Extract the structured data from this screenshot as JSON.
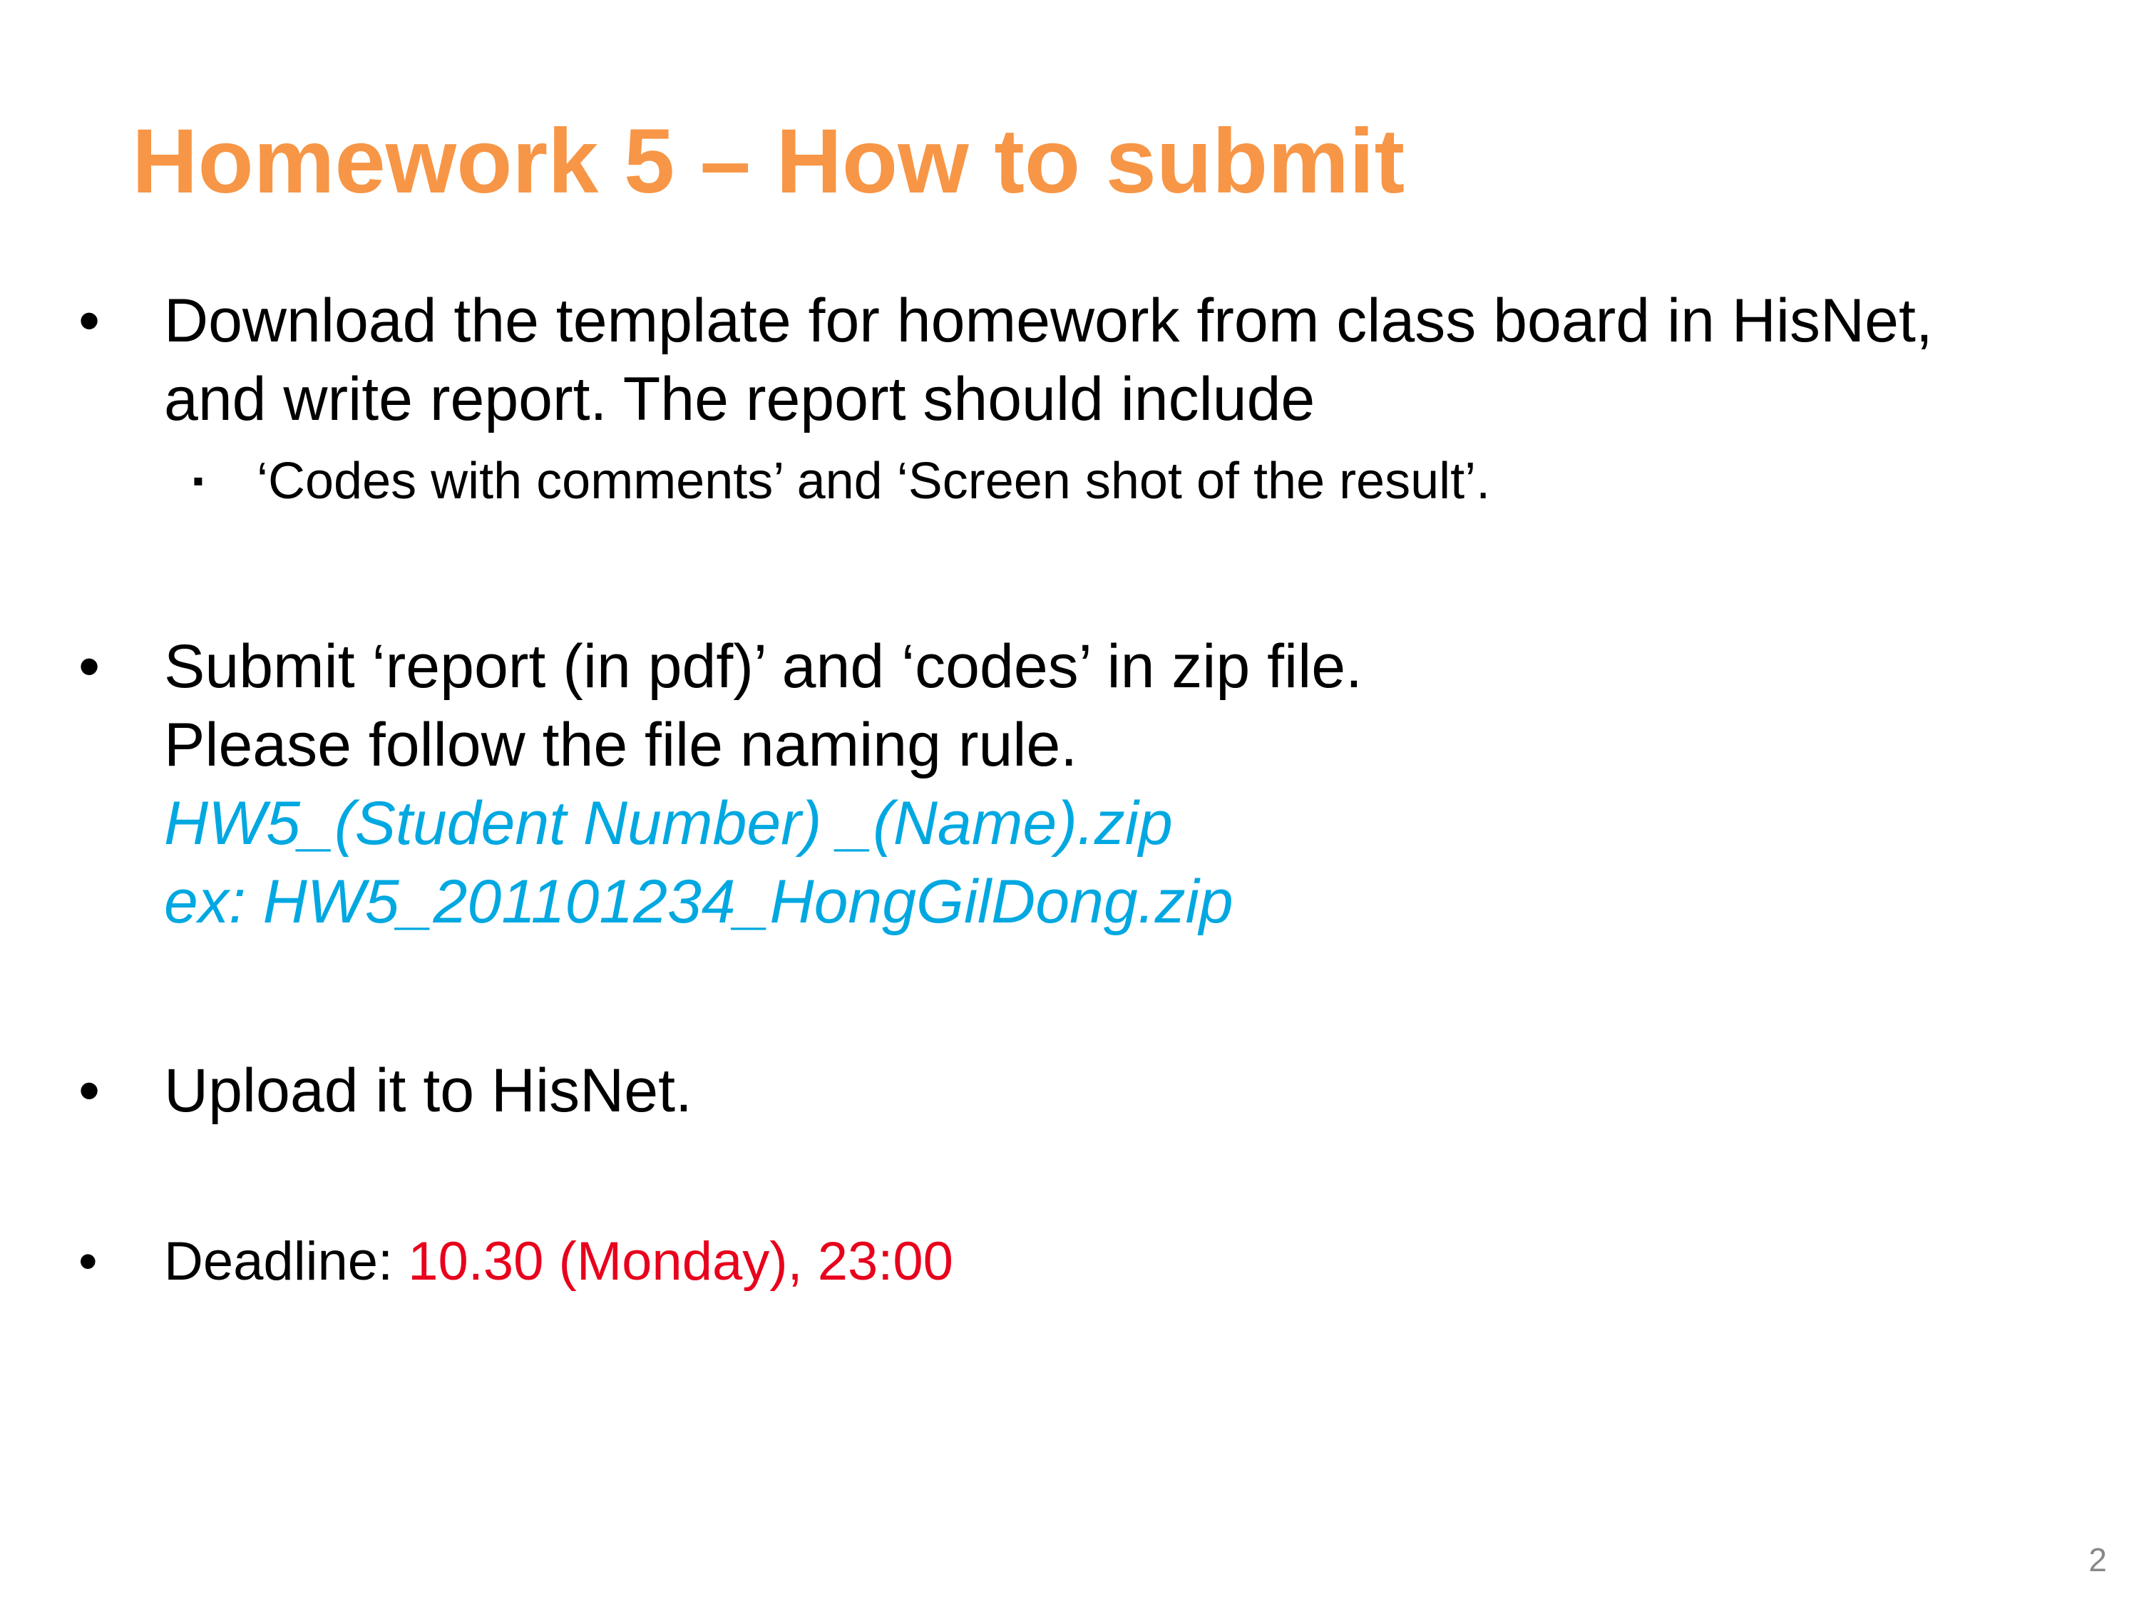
{
  "colors": {
    "title": "#f79646",
    "filename": "#00a8e1",
    "deadline": "#e8001c",
    "text": "#000000"
  },
  "slide": {
    "title": "Homework 5 – How to submit",
    "bullets": [
      {
        "marker": "•",
        "lines": [
          "Download the template for homework from class board in HisNet,",
          "and write report. The report should include"
        ],
        "sub_marker": "▪",
        "sub_text": "‘Codes with comments’ and ‘Screen shot of the result’."
      },
      {
        "marker": "•",
        "lines": [
          "Submit ‘report (in pdf)’ and ‘codes’ in zip file.",
          "Please follow the file naming rule."
        ],
        "filename_rule": "HW5_(Student Number) _(Name).zip",
        "filename_example": "ex: HW5_201101234_HongGilDong.zip"
      },
      {
        "marker": "•",
        "text": "Upload it to HisNet."
      },
      {
        "marker": "•",
        "label": "Deadline: ",
        "value": "10.30 (Monday), 23:00"
      }
    ],
    "page_number": "2"
  }
}
